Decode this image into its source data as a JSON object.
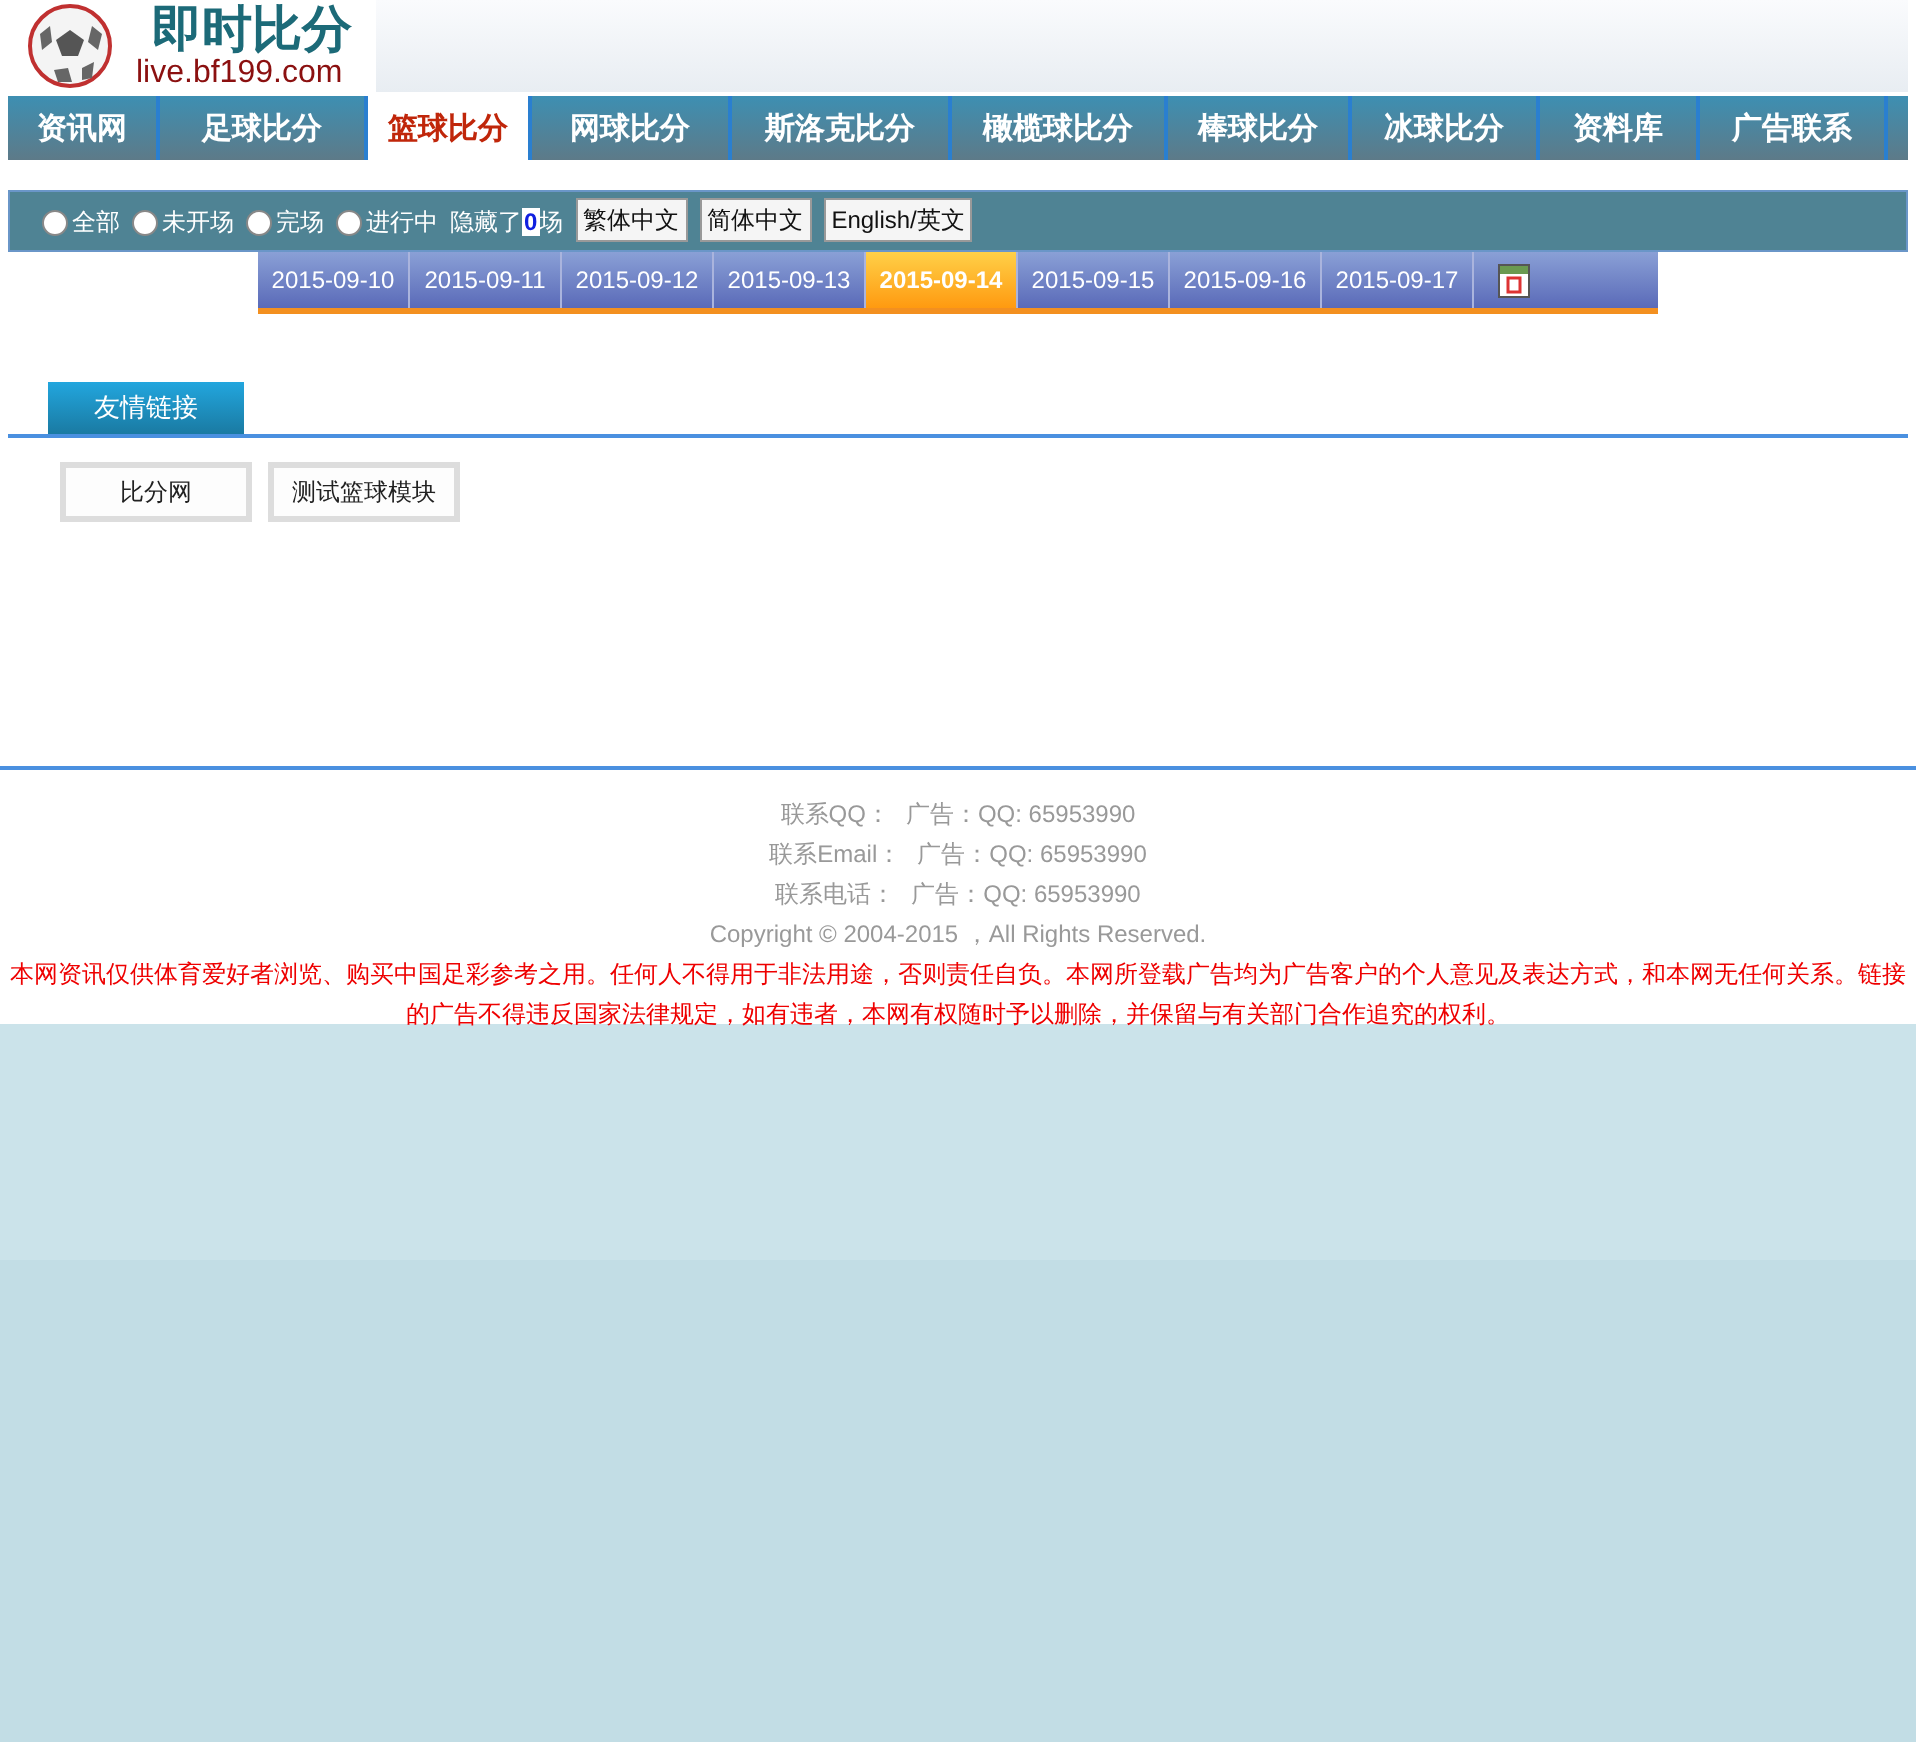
{
  "logo": {
    "title": "即时比分",
    "domain": "live.bf199.com"
  },
  "nav": [
    {
      "label": "资讯网",
      "selected": false
    },
    {
      "label": "足球比分",
      "selected": false
    },
    {
      "label": "篮球比分",
      "selected": true
    },
    {
      "label": "网球比分",
      "selected": false
    },
    {
      "label": "斯洛克比分",
      "selected": false
    },
    {
      "label": "橄榄球比分",
      "selected": false
    },
    {
      "label": "棒球比分",
      "selected": false
    },
    {
      "label": "冰球比分",
      "selected": false
    },
    {
      "label": "资料库",
      "selected": false
    },
    {
      "label": "广告联系",
      "selected": false
    }
  ],
  "filters": [
    {
      "label": "全部",
      "selected": false
    },
    {
      "label": "未开场",
      "selected": false
    },
    {
      "label": "完场",
      "selected": false
    },
    {
      "label": "进行中",
      "selected": false
    }
  ],
  "hidden": {
    "before": "隐藏了",
    "count": "0",
    "after": "场"
  },
  "language_buttons": [
    "繁体中文",
    "简体中文",
    "English/英文"
  ],
  "dates": [
    {
      "label": "2015-09-10",
      "selected": false
    },
    {
      "label": "2015-09-11",
      "selected": false
    },
    {
      "label": "2015-09-12",
      "selected": false
    },
    {
      "label": "2015-09-13",
      "selected": false
    },
    {
      "label": "2015-09-14",
      "selected": true
    },
    {
      "label": "2015-09-15",
      "selected": false
    },
    {
      "label": "2015-09-16",
      "selected": false
    },
    {
      "label": "2015-09-17",
      "selected": false
    }
  ],
  "friend_links": {
    "tab": "友情链接",
    "links": [
      "比分网",
      "测试篮球模块"
    ]
  },
  "footer": {
    "contacts": [
      {
        "label": "联系QQ：",
        "value": "广告：QQ: 65953990"
      },
      {
        "label": "联系Email：",
        "value": "广告：QQ: 65953990"
      },
      {
        "label": "联系电话：",
        "value": "广告：QQ: 65953990"
      }
    ],
    "copyright": "Copyright © 2004-2015 ，All Rights Reserved.",
    "disclaimer": "本网资讯仅供体育爱好者浏览、购买中国足彩参考之用。任何人不得用于非法用途，否则责任自负。本网所登载广告均为广告客户的个人意见及表达方式，和本网无任何关系。链接的广告不得违反国家法律规定，如有违者，本网有权随时予以删除，并保留与有关部门合作追究的权利。"
  }
}
